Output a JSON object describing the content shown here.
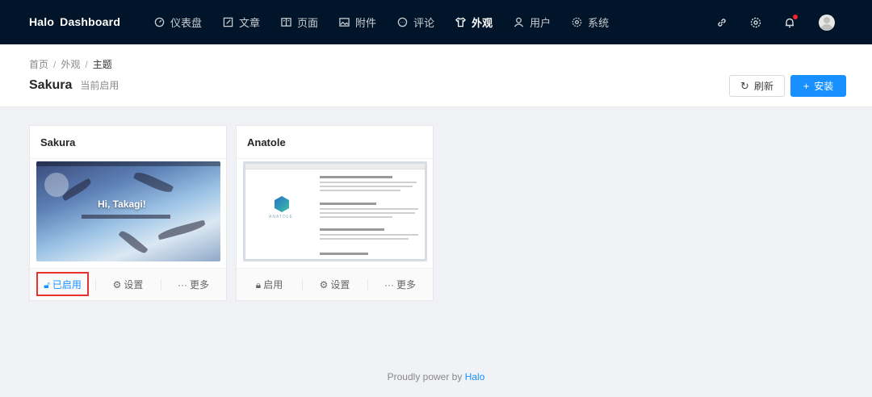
{
  "brand": {
    "part1": "Halo",
    "part2": "Dashboard"
  },
  "nav": [
    {
      "label": "仪表盘",
      "icon": "dashboard-icon"
    },
    {
      "label": "文章",
      "icon": "edit-icon"
    },
    {
      "label": "页面",
      "icon": "book-icon"
    },
    {
      "label": "附件",
      "icon": "picture-icon"
    },
    {
      "label": "评论",
      "icon": "comment-icon"
    },
    {
      "label": "外观",
      "icon": "skin-icon",
      "active": true
    },
    {
      "label": "用户",
      "icon": "user-icon"
    },
    {
      "label": "系统",
      "icon": "setting-icon"
    }
  ],
  "breadcrumb": {
    "home": "首页",
    "appearance": "外观",
    "current": "主题",
    "sep": "/"
  },
  "header": {
    "title": "Sakura",
    "subtitle": "当前启用"
  },
  "buttons": {
    "refresh": "刷新",
    "install": "安装"
  },
  "themes": [
    {
      "name": "Sakura",
      "cover_text": "Hi, Takagi!",
      "actions": {
        "status": "已启用",
        "settings": "设置",
        "more": "更多"
      }
    },
    {
      "name": "Anatole",
      "cover_text": "ANATOLE",
      "actions": {
        "status": "启用",
        "settings": "设置",
        "more": "更多"
      }
    }
  ],
  "footer": {
    "text": "Proudly power by",
    "link": "Halo"
  },
  "colors": {
    "topbar": "#001529",
    "primary": "#1890ff",
    "highlight": "#e8302d"
  }
}
